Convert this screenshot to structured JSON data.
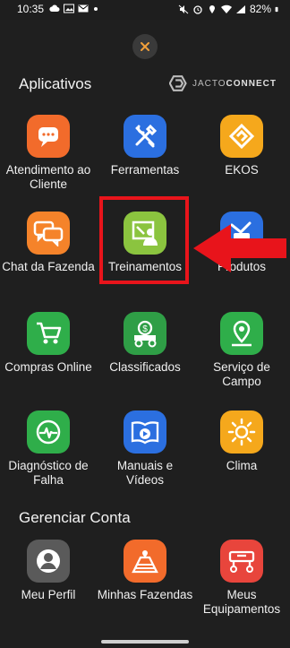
{
  "status": {
    "time": "10:35",
    "battery": "82%"
  },
  "sections": {
    "apps_title": "Aplicativos",
    "account_title": "Gerenciar Conta"
  },
  "brand": {
    "prefix": "JACTO",
    "suffix": "CONNECT"
  },
  "apps": [
    {
      "label": "Atendimento ao Cliente",
      "icon": "chat-bubble-icon",
      "color": "#f26b2b"
    },
    {
      "label": "Ferramentas",
      "icon": "tools-icon",
      "color": "#2b6fe0"
    },
    {
      "label": "EKOS",
      "icon": "ekos-logo-icon",
      "color": "#f5a81c"
    },
    {
      "label": "Chat da Fazenda",
      "icon": "chat-bubbles-icon",
      "color": "#f5832a"
    },
    {
      "label": "Treinamentos",
      "icon": "training-icon",
      "color": "#8bc43f"
    },
    {
      "label": "Produtos",
      "icon": "product-icon",
      "color": "#2b6fe0"
    },
    {
      "label": "Compras Online",
      "icon": "cart-icon",
      "color": "#2fae4a"
    },
    {
      "label": "Classificados",
      "icon": "tractor-money-icon",
      "color": "#2f9e46"
    },
    {
      "label": "Serviço de Campo",
      "icon": "location-pin-icon",
      "color": "#2fae4a"
    },
    {
      "label": "Diagnóstico de Falha",
      "icon": "diagnostic-icon",
      "color": "#2fae4a"
    },
    {
      "label": "Manuais e Vídeos",
      "icon": "manual-video-icon",
      "color": "#2b6fe0"
    },
    {
      "label": "Clima",
      "icon": "sun-icon",
      "color": "#f5a81c"
    }
  ],
  "account": [
    {
      "label": "Meu Perfil",
      "icon": "profile-icon",
      "color": "#5a5a5a"
    },
    {
      "label": "Minhas Fazendas",
      "icon": "farm-icon",
      "color": "#f26b2b"
    },
    {
      "label": "Meus Equipamentos",
      "icon": "equipment-icon",
      "color": "#e8453c"
    }
  ],
  "colors": {
    "highlight": "#e8141b",
    "background": "#1f1f1f"
  }
}
